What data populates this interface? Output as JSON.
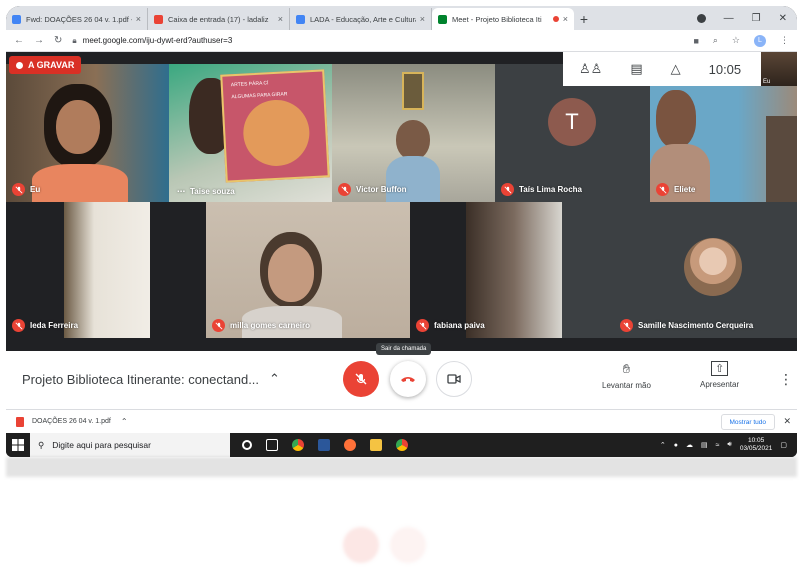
{
  "browser": {
    "tabs": [
      {
        "label": "Fwd: DOAÇÕES 26 04 v. 1.pdf - l",
        "favicon_color": "#4285f4",
        "active": false
      },
      {
        "label": "Caixa de entrada (17) - ladaliz",
        "favicon_color": "#ea4335",
        "active": false
      },
      {
        "label": "LADA - Educação, Arte e Cultura",
        "favicon_color": "#4285f4",
        "active": false
      },
      {
        "label": "Meet - Projeto Biblioteca Iti",
        "favicon_color": "#00832d",
        "active": true
      }
    ],
    "new_tab_glyph": "+",
    "url": "meet.google.com/iju-dywt-erd?authuser=3",
    "profile_initial": "L"
  },
  "meet": {
    "recording_label": "A GRAVAR",
    "clock": "10:05",
    "self_thumb_label": "Eu",
    "tiles": [
      {
        "name": "Eu"
      },
      {
        "name": "Taise souza"
      },
      {
        "name": "Victor Buffon"
      },
      {
        "name": "Taís Lima Rocha",
        "avatar_initial": "T"
      },
      {
        "name": "Eliete"
      },
      {
        "name": "Ieda Ferreira"
      },
      {
        "name": "milla gomes carneiro"
      },
      {
        "name": "fabiana paiva"
      },
      {
        "name": "Samille Nascimento Cerqueira"
      }
    ],
    "book_text_line1": "ARTES PÁRA CÍ",
    "book_text_line2": "ALGUMAS PARA GIRAR"
  },
  "controls": {
    "meeting_title": "Projeto Biblioteca Itinerante: conectand...",
    "hangup_tooltip": "Sair da chamada",
    "raise_hand_label": "Levantar mão",
    "present_label": "Apresentar"
  },
  "downloads": {
    "file_name": "DOAÇÕES 26 04 v. 1.pdf",
    "show_all_label": "Mostrar tudo"
  },
  "taskbar": {
    "search_placeholder": "Digite aqui para pesquisar",
    "time": "10:05",
    "date": "03/05/2021"
  },
  "colors": {
    "meet_dark": "#202124",
    "mic_off_red": "#ea4335",
    "recording_red": "#d93025",
    "avatar_t": "#8d5a4e"
  }
}
